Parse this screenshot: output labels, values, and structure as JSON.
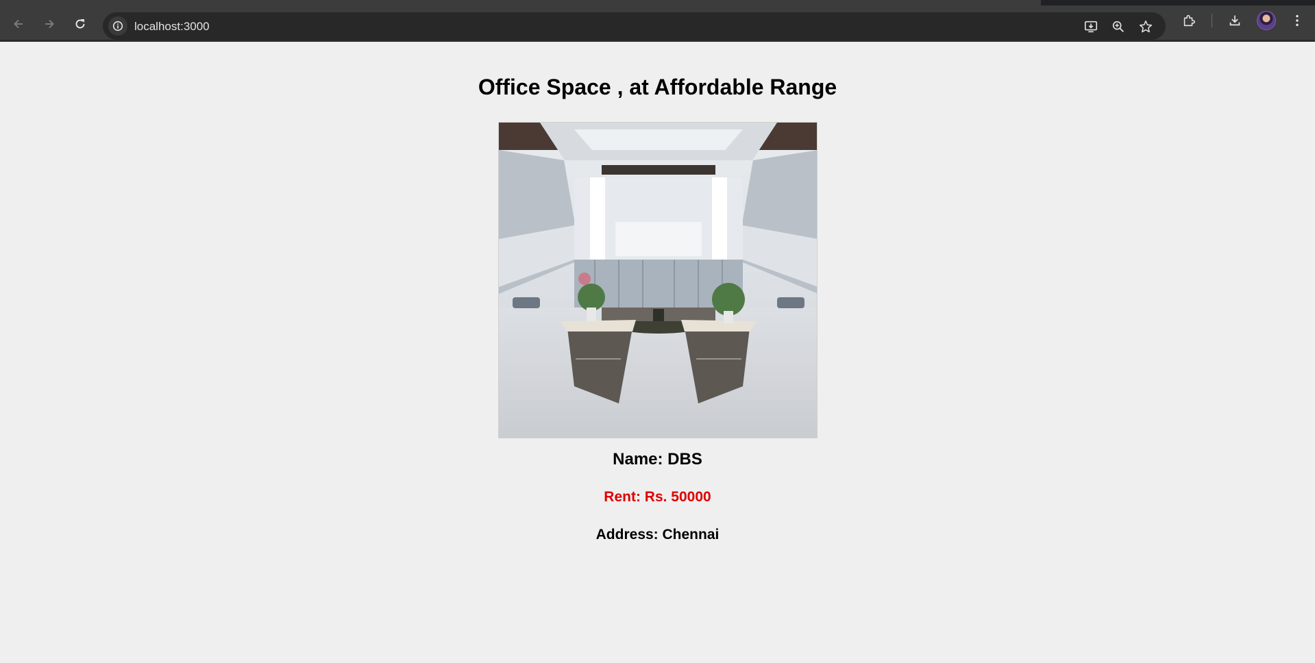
{
  "browser": {
    "url": "localhost:3000",
    "icons": {
      "back": "back-arrow-icon",
      "forward": "forward-arrow-icon",
      "reload": "reload-icon",
      "site_info": "info-icon",
      "install": "install-app-icon",
      "zoom": "zoom-icon",
      "bookmark": "star-icon",
      "extensions": "puzzle-icon",
      "downloads": "download-icon",
      "menu": "kebab-menu-icon"
    }
  },
  "page": {
    "title": "Office Space , at Affordable Range",
    "listing": {
      "name": "Name: DBS",
      "rent": "Rent: Rs. 50000",
      "address": "Address: Chennai"
    }
  },
  "colors": {
    "page_background": "#efefef",
    "rent_text": "#e00000",
    "toolbar": "#3c3c3c"
  }
}
